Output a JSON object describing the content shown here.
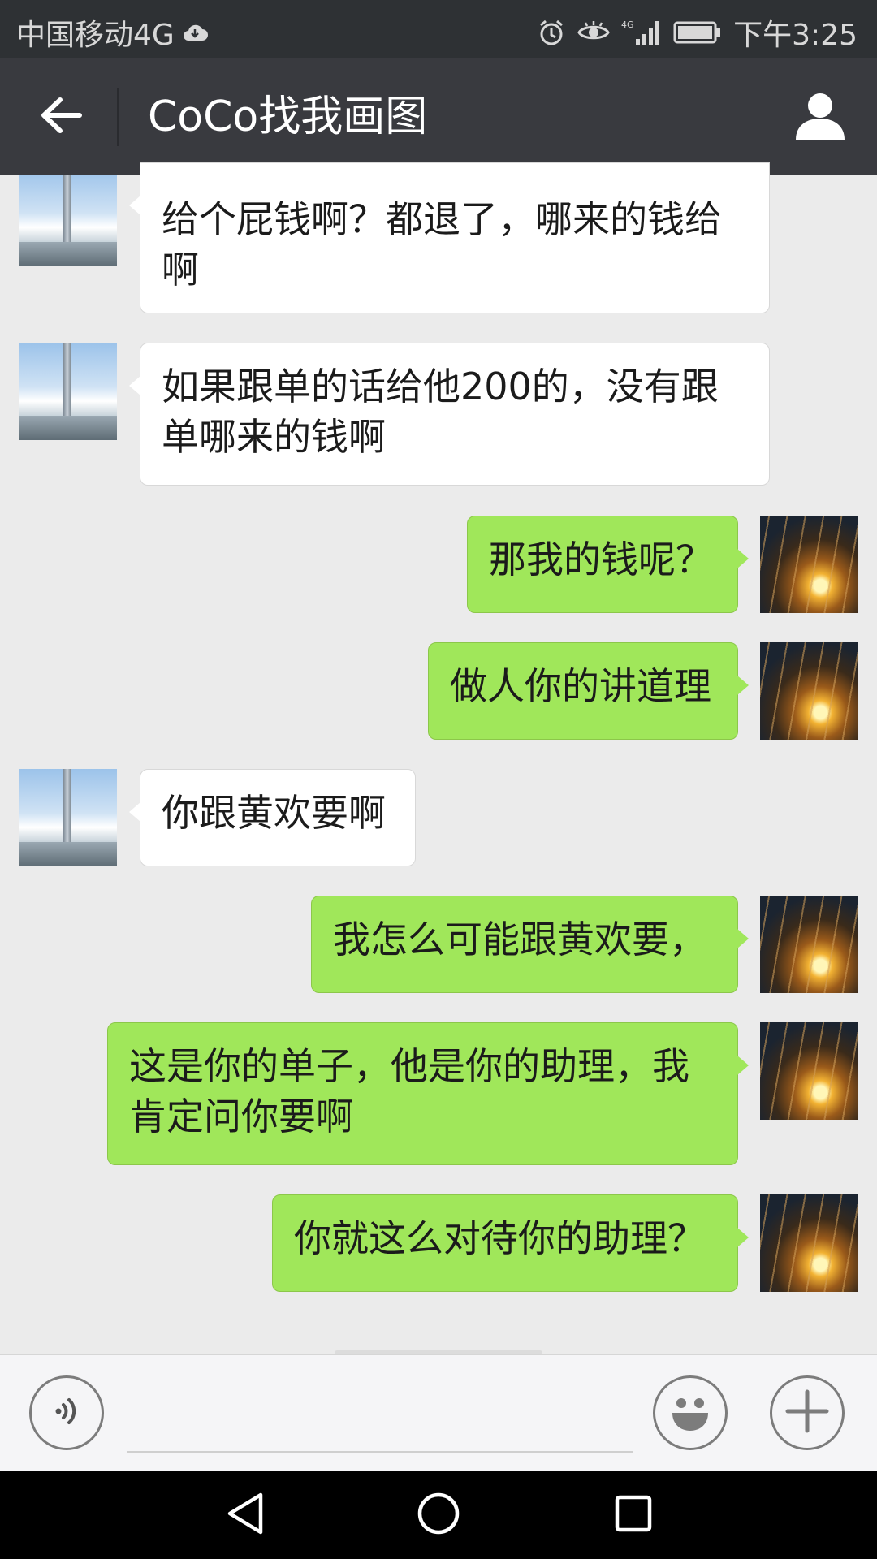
{
  "status_bar": {
    "carrier": "中国移动4G",
    "time": "下午3:25",
    "icons": [
      "cloud-icon",
      "alarm-icon",
      "eye-icon",
      "signal-4g-icon",
      "battery-icon"
    ]
  },
  "title_bar": {
    "title": "CoCo找我画图",
    "icons": [
      "back-arrow-icon",
      "contact-profile-icon"
    ]
  },
  "messages": [
    {
      "side": "incoming",
      "text": "给个屁钱啊？都退了，哪来的钱给啊"
    },
    {
      "side": "incoming",
      "text": "如果跟单的话给他200的，没有跟单哪来的钱啊"
    },
    {
      "side": "outgoing",
      "text": "那我的钱呢？"
    },
    {
      "side": "outgoing",
      "text": "做人你的讲道理"
    },
    {
      "side": "incoming",
      "text": "你跟黄欢要啊"
    },
    {
      "side": "outgoing",
      "text": "我怎么可能跟黄欢要，"
    },
    {
      "side": "outgoing",
      "text": "这是你的单子，他是你的助理，我肯定问你要啊"
    },
    {
      "side": "outgoing",
      "text": "你就这么对待你的助理？"
    }
  ],
  "input_bar": {
    "icons": [
      "voice-icon",
      "emoji-icon",
      "plus-icon"
    ],
    "text_value": ""
  },
  "nav_bar": {
    "icons": [
      "back-triangle-icon",
      "home-circle-icon",
      "recents-square-icon"
    ]
  },
  "colors": {
    "status_bar_bg": "#2e3134",
    "title_bar_bg": "#393a3f",
    "chat_bg": "#ebebeb",
    "outgoing_bubble": "#a0e75a",
    "incoming_bubble": "#ffffff"
  }
}
